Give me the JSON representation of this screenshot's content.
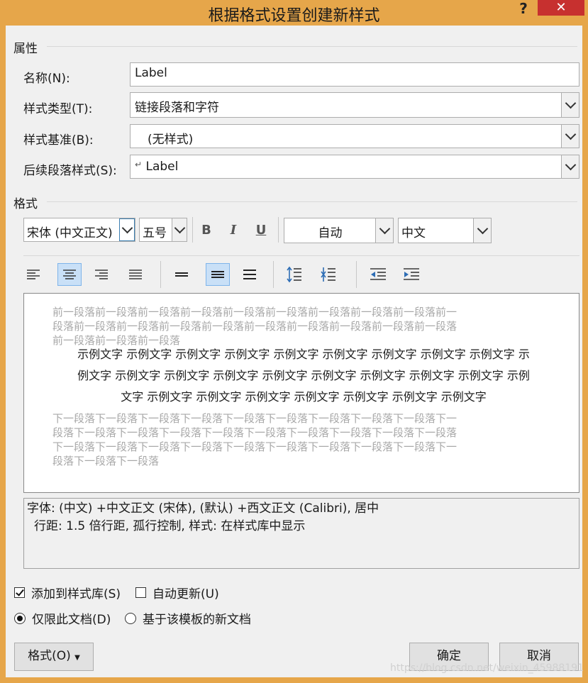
{
  "window": {
    "title": "根据格式设置创建新样式",
    "help_label": "?",
    "close_label": "✕"
  },
  "properties": {
    "section_label": "属性",
    "name_label": "名称(N):",
    "name_value": "Label",
    "type_label": "样式类型(T):",
    "type_value": "链接段落和字符",
    "based_label": "样式基准(B):",
    "based_value": "(无样式)",
    "next_label": "后续段落样式(S):",
    "next_value": "Label",
    "next_icon": "↵"
  },
  "format": {
    "section_label": "格式",
    "font_value": "宋体 (中文正文)",
    "size_value": "五号",
    "bold_label": "B",
    "italic_label": "I",
    "underline_label": "U",
    "color_value": "自动",
    "script_value": "中文"
  },
  "preview": {
    "prev_lines": [
      "前一段落前一段落前一段落前一段落前一段落前一段落前一段落前一段落前一段落前一",
      "段落前一段落前一段落前一段落前一段落前一段落前一段落前一段落前一段落前一段落",
      "前一段落前一段落前一段落"
    ],
    "sample_lines": [
      "示例文字 示例文字 示例文字 示例文字 示例文字 示例文字 示例文字 示例文字 示例文字 示",
      "例文字 示例文字 示例文字 示例文字 示例文字 示例文字 示例文字 示例文字 示例文字 示例",
      "文字 示例文字 示例文字 示例文字 示例文字 示例文字 示例文字 示例文字"
    ],
    "next_lines": [
      "下一段落下一段落下一段落下一段落下一段落下一段落下一段落下一段落下一段落下一",
      "段落下一段落下一段落下一段落下一段落下一段落下一段落下一段落下一段落下一段落",
      "下一段落下一段落下一段落下一段落下一段落下一段落下一段落下一段落下一段落下一",
      "段落下一段落下一段落"
    ]
  },
  "description": {
    "line1": "字体: (中文) +中文正文 (宋体), (默认) +西文正文 (Calibri), 居中",
    "line2": "行距: 1.5 倍行距, 孤行控制, 样式: 在样式库中显示"
  },
  "options": {
    "add_to_gallery_label": "添加到样式库(S)",
    "add_to_gallery_checked": true,
    "auto_update_label": "自动更新(U)",
    "auto_update_checked": false,
    "this_doc_label": "仅限此文档(D)",
    "template_label": "基于该模板的新文档"
  },
  "buttons": {
    "format_label": "格式(O)",
    "ok_label": "确定",
    "cancel_label": "取消"
  },
  "watermark": "https://blog.csdn.net/weixin_45988191",
  "colors": {
    "title_bar": "#e6a64a",
    "close_button": "#c7302f",
    "selected_tool": "#c9e0f7"
  }
}
